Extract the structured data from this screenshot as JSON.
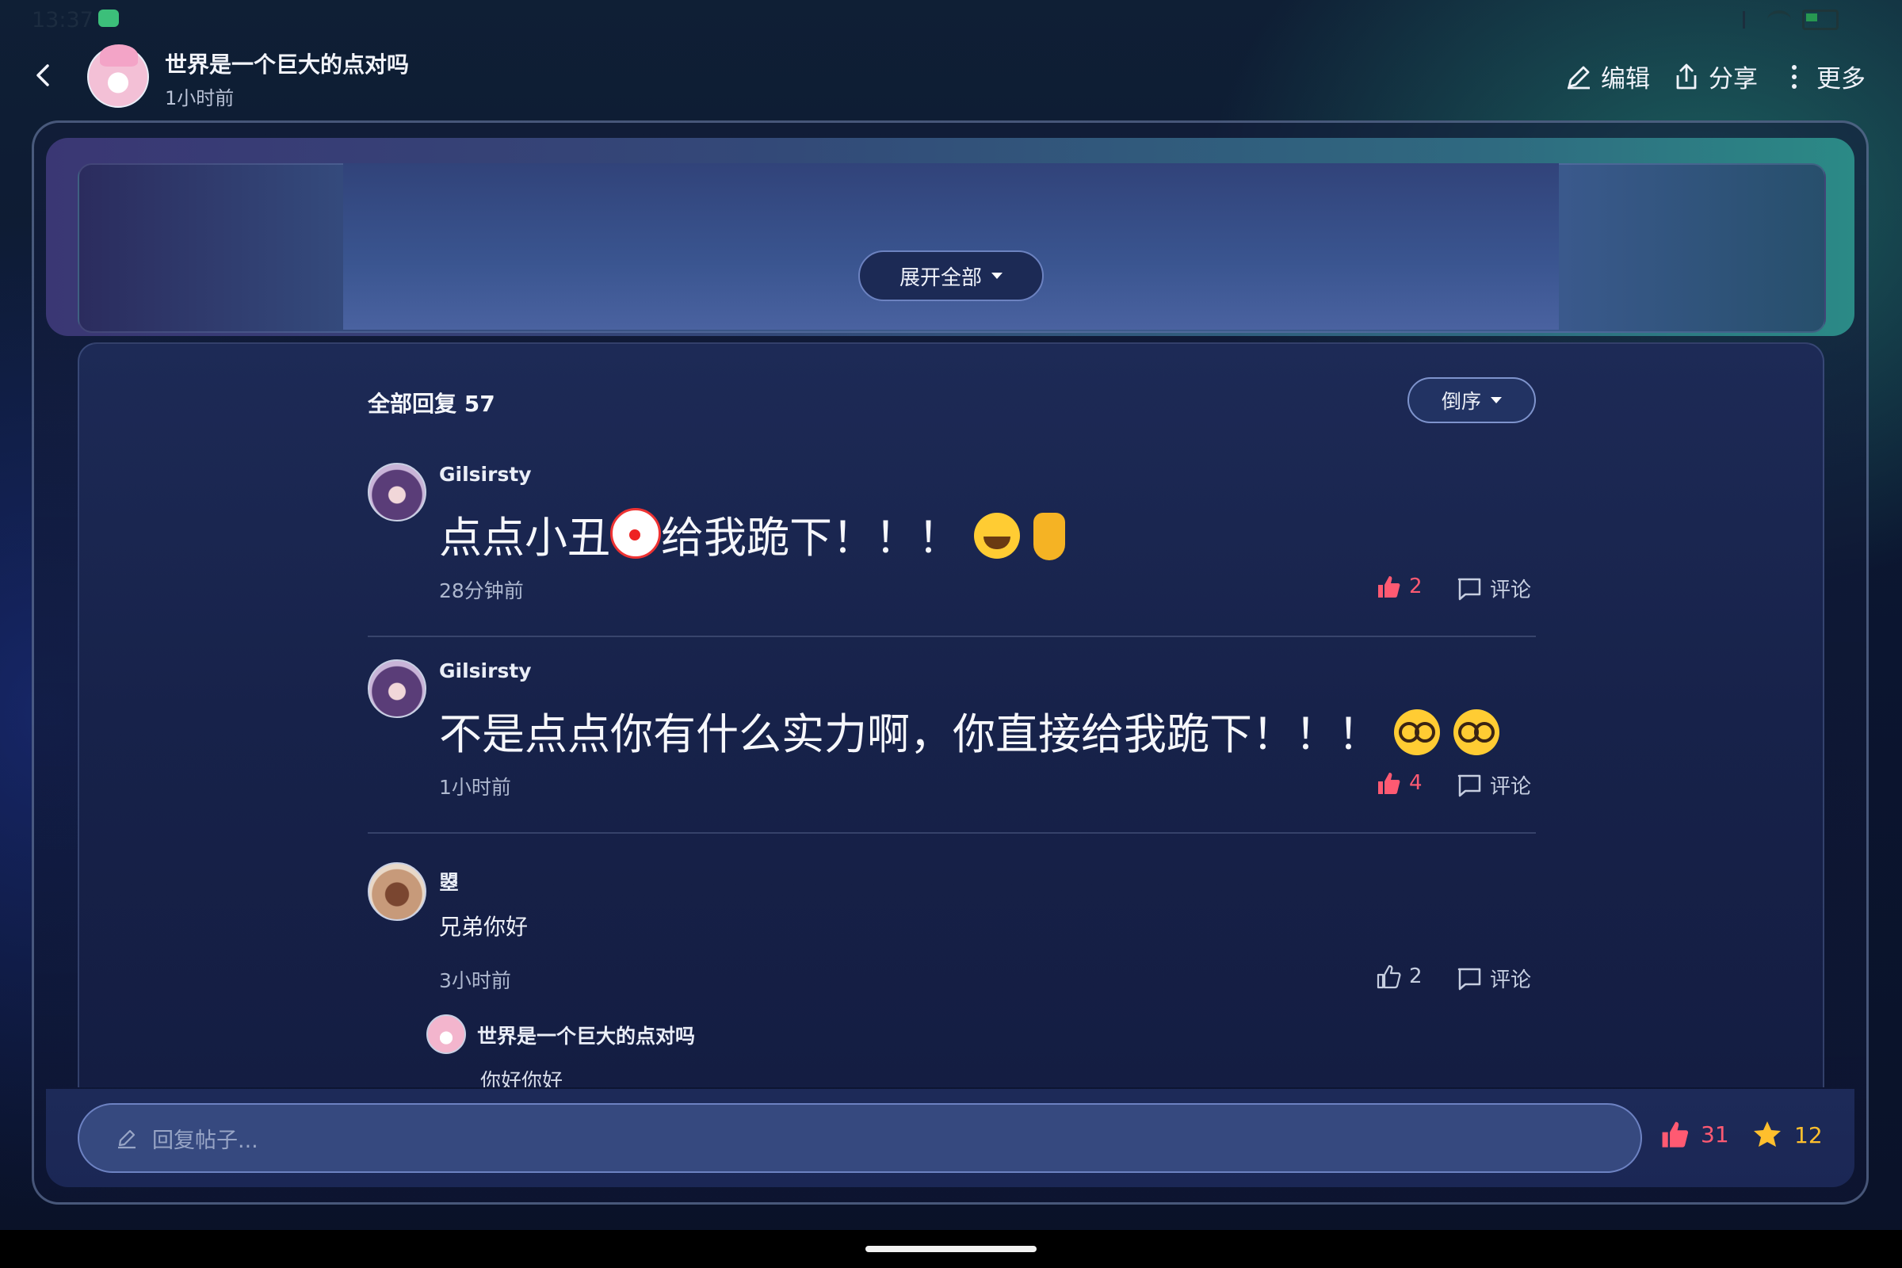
{
  "status_bar": {
    "time": "13:37"
  },
  "header": {
    "author_name": "世界是一个巨大的点对吗",
    "post_time": "1小时前",
    "actions": {
      "edit": "编辑",
      "share": "分享",
      "more": "更多"
    }
  },
  "content": {
    "expand_label": "展开全部"
  },
  "replies": {
    "title": "全部回复 57",
    "sort_label": "倒序",
    "comment_label": "评论",
    "items": [
      {
        "user": "Gilsirsty",
        "text_a": "点点小丑",
        "text_b": "给我跪下！！！",
        "time": "28分钟前",
        "likes": "2",
        "liked": true
      },
      {
        "user": "Gilsirsty",
        "text": "不是点点你有什么实力啊，你直接给我跪下！！！",
        "time": "1小时前",
        "likes": "4",
        "liked": true
      },
      {
        "user": "曌",
        "text": "兄弟你好",
        "time": "3小时前",
        "likes": "2",
        "liked": false,
        "sub_reply": {
          "user": "世界是一个巨大的点对吗",
          "text": "你好你好"
        }
      }
    ]
  },
  "reply_bar": {
    "placeholder": "回复帖子...",
    "likes": "31",
    "favorites": "12"
  },
  "colors": {
    "like_active": "#ff5a72",
    "favorite": "#ffbf2d",
    "accent_teal": "#2b8a86"
  },
  "icons": {
    "back": "chevron-left-icon",
    "edit": "pencil-icon",
    "share": "share-icon",
    "more": "more-vertical-icon",
    "like": "thumbs-up-icon",
    "comment": "comment-icon",
    "favorite": "star-icon"
  }
}
